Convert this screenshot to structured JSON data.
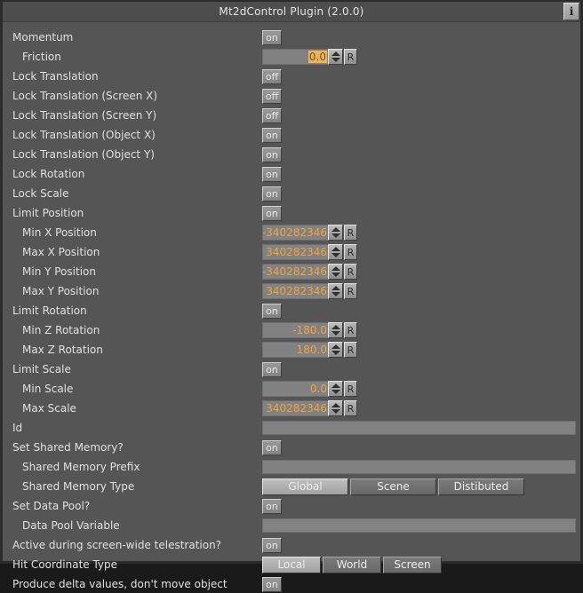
{
  "titlebar": {
    "title": "Mt2dControl Plugin (2.0.0)",
    "info_button": "i"
  },
  "rows": [
    {
      "label": "Momentum",
      "type": "toggle",
      "value": "on",
      "indent": false
    },
    {
      "label": "Friction",
      "type": "number",
      "value": "0.0",
      "indent": true,
      "selected": true,
      "reset": "R"
    },
    {
      "label": "Lock Translation",
      "type": "toggle",
      "value": "off",
      "indent": false
    },
    {
      "label": "Lock Translation (Screen X)",
      "type": "toggle",
      "value": "off",
      "indent": false
    },
    {
      "label": "Lock Translation (Screen Y)",
      "type": "toggle",
      "value": "off",
      "indent": false
    },
    {
      "label": "Lock Translation (Object X)",
      "type": "toggle",
      "value": "on",
      "indent": false
    },
    {
      "label": "Lock Translation (Object Y)",
      "type": "toggle",
      "value": "on",
      "indent": false
    },
    {
      "label": "Lock Rotation",
      "type": "toggle",
      "value": "on",
      "indent": false
    },
    {
      "label": "Lock Scale",
      "type": "toggle",
      "value": "on",
      "indent": false
    },
    {
      "label": "Limit Position",
      "type": "toggle",
      "value": "on",
      "indent": false
    },
    {
      "label": "Min X Position",
      "type": "number",
      "value": "-340282346",
      "indent": true,
      "selected": false,
      "reset": "R"
    },
    {
      "label": "Max X Position",
      "type": "number",
      "value": "340282346",
      "indent": true,
      "selected": false,
      "reset": "R"
    },
    {
      "label": "Min Y Position",
      "type": "number",
      "value": "-340282346",
      "indent": true,
      "selected": false,
      "reset": "R"
    },
    {
      "label": "Max Y Position",
      "type": "number",
      "value": "340282346",
      "indent": true,
      "selected": false,
      "reset": "R"
    },
    {
      "label": "Limit Rotation",
      "type": "toggle",
      "value": "on",
      "indent": false
    },
    {
      "label": "Min Z Rotation",
      "type": "number",
      "value": "-180.0",
      "indent": true,
      "selected": false,
      "reset": "R"
    },
    {
      "label": "Max Z Rotation",
      "type": "number",
      "value": "180.0",
      "indent": true,
      "selected": false,
      "reset": "R"
    },
    {
      "label": "Limit Scale",
      "type": "toggle",
      "value": "on",
      "indent": false
    },
    {
      "label": "Min Scale",
      "type": "number",
      "value": "0.0",
      "indent": true,
      "selected": false,
      "reset": "R"
    },
    {
      "label": "Max Scale",
      "type": "number",
      "value": "340282346",
      "indent": true,
      "selected": false,
      "reset": "R"
    },
    {
      "label": "Id",
      "type": "text",
      "value": "",
      "indent": false
    },
    {
      "label": "Set Shared Memory?",
      "type": "toggle",
      "value": "on",
      "indent": false
    },
    {
      "label": "Shared Memory Prefix",
      "type": "text",
      "value": "",
      "indent": true
    },
    {
      "label": "Shared Memory Type",
      "type": "segment",
      "indent": true,
      "options": [
        "Global",
        "Scene",
        "Distibuted"
      ],
      "selected_index": 0,
      "seg_width": "w97"
    },
    {
      "label": "Set Data Pool?",
      "type": "toggle",
      "value": "on",
      "indent": false
    },
    {
      "label": "Data Pool Variable",
      "type": "text",
      "value": "",
      "indent": true
    },
    {
      "label": "Active during screen-wide telestration?",
      "type": "toggle",
      "value": "on",
      "indent": false
    },
    {
      "label": "Hit Coordinate Type",
      "type": "segment",
      "indent": false,
      "options": [
        "Local",
        "World",
        "Screen"
      ],
      "selected_index": 0,
      "seg_width": "w66"
    },
    {
      "label": "Produce delta values, don't move object",
      "type": "toggle",
      "value": "on",
      "indent": false
    }
  ],
  "colors": {
    "window_bg": "#555555",
    "titlebar_bg": "#4d4d4d",
    "value_orange": "#f2a33c",
    "field_bg": "#828282",
    "border_dark": "#2b2b2b"
  }
}
